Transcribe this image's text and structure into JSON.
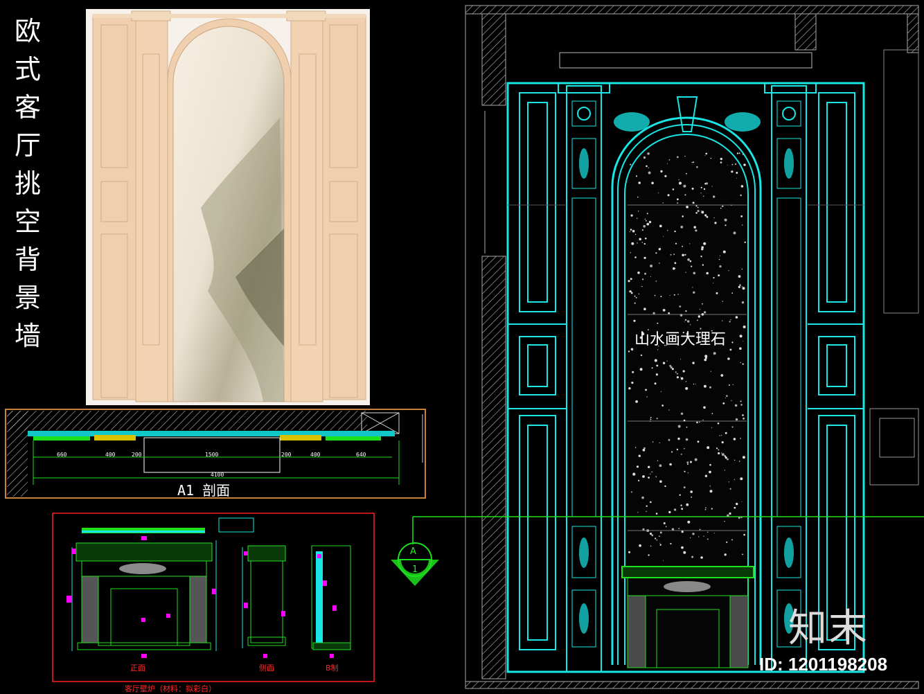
{
  "title_vertical": [
    "欧",
    "式",
    "客",
    "厅",
    "挑",
    "空",
    "背",
    "景",
    "墙"
  ],
  "elevation": {
    "marble_label": "山水画大理石"
  },
  "section": {
    "label": "A1 剖面",
    "dims": [
      "660",
      "400",
      "200",
      "1500",
      "200",
      "400",
      "640"
    ],
    "total": "4100"
  },
  "fireplace": {
    "front_label": "正面",
    "side_label": "侧面",
    "back_label": "B制",
    "caption": "客厅壁炉（材料：拟彩白）"
  },
  "section_ref": {
    "letter": "A",
    "number": "1"
  },
  "watermark": {
    "brand": "知末",
    "id": "ID: 1201198208"
  },
  "colors": {
    "cad_cyan": "#19e6e6",
    "cad_green": "#1ee11e",
    "cad_magenta": "#ff00ff",
    "cad_red": "#ff1e1e",
    "stone": "#efcfae"
  }
}
